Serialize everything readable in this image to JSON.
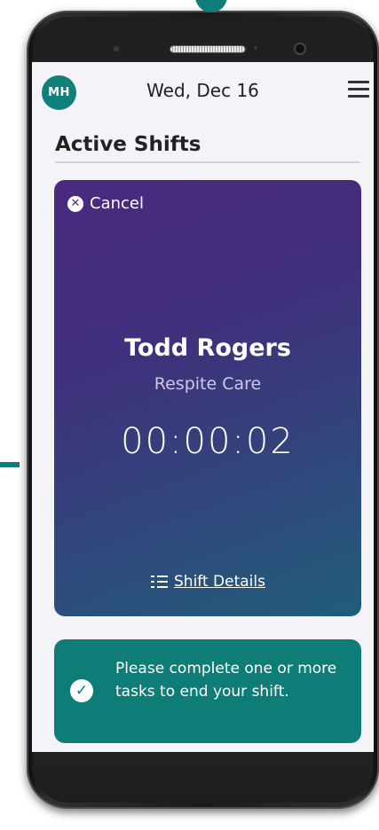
{
  "header": {
    "avatar_initials": "MH",
    "date": "Wed, Dec 16",
    "menu_icon": "hamburger-menu-icon"
  },
  "main": {
    "section_title": "Active Shifts",
    "shift_card": {
      "cancel_label": "Cancel",
      "cancel_icon": "x-circle-icon",
      "client_name": "Todd Rogers",
      "service_type": "Respite Care",
      "timer": "00:00:02",
      "details_label": "Shift Details",
      "details_icon": "checklist-icon"
    },
    "task_banner": {
      "message": "Please complete one or more tasks to end your shift.",
      "icon": "check-circle-icon"
    }
  },
  "colors": {
    "brand_teal": "#0f7d79",
    "card_gradient_top": "#4a2a7e",
    "card_gradient_bottom": "#205e7a",
    "screen_background": "#f3f3f8"
  }
}
